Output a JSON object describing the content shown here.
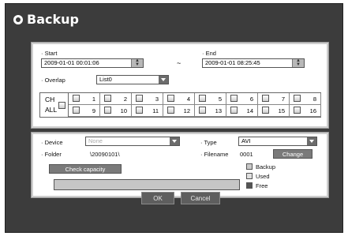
{
  "window": {
    "title": "Backup"
  },
  "range": {
    "start_label": "· Start",
    "start_value": "2009-01-01 00:01:06",
    "separator": "~",
    "end_label": "· End",
    "end_value": "2009-01-01 08:25:45",
    "overlap_label": "· Overlap",
    "overlap_value": "List0"
  },
  "channels": {
    "all_line1": "CH",
    "all_line2": "ALL",
    "items": [
      "1",
      "2",
      "3",
      "4",
      "5",
      "6",
      "7",
      "8",
      "9",
      "10",
      "11",
      "12",
      "13",
      "14",
      "15",
      "16"
    ]
  },
  "device": {
    "device_label": "· Device",
    "device_placeholder": "None",
    "type_label": "· Type",
    "type_value": "AVI",
    "folder_label": "· Folder",
    "folder_value": "\\20090101\\",
    "filename_label": "· Filename",
    "filename_value": "0001",
    "change_label": "Change",
    "check_capacity_label": "Check capacity",
    "legend": {
      "backup": "Backup",
      "used": "Used",
      "free": "Free"
    },
    "legend_colors": {
      "backup": "#c9c9c9",
      "used": "#e0e0e0",
      "free": "#555555"
    }
  },
  "buttons": {
    "ok": "OK",
    "cancel": "Cancel"
  }
}
